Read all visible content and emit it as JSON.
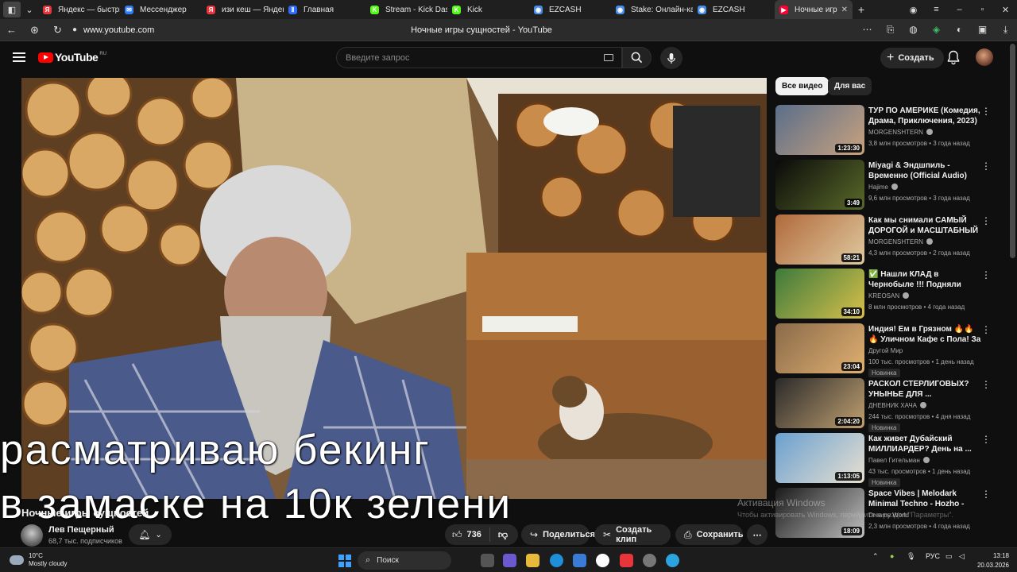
{
  "browser": {
    "tabs": [
      {
        "label": "Яндекс — быстрый",
        "color": "#e8343b",
        "glyph": "Я"
      },
      {
        "label": "Мессенджер",
        "color": "#2f7cf6",
        "glyph": "✉"
      },
      {
        "label": "изи кеш — Яндекс",
        "color": "#e8343b",
        "glyph": "Я"
      },
      {
        "label": "Главная",
        "color": "#2f6bff",
        "glyph": "Ⅱ"
      },
      {
        "label": "Stream - Kick Dash",
        "color": "#53fc18",
        "glyph": "K"
      },
      {
        "label": "Kick",
        "color": "#53fc18",
        "glyph": "K"
      },
      {
        "label": "EZCASH",
        "color": "#4a8fe7",
        "glyph": "◉"
      },
      {
        "label": "Stake: Онлайн-ка",
        "color": "#4a8fe7",
        "glyph": "◉"
      },
      {
        "label": "EZCASH",
        "color": "#4a8fe7",
        "glyph": "◉"
      },
      {
        "label": "Ночные игр",
        "color": "#ff0033",
        "glyph": "▶"
      }
    ],
    "url": "www.youtube.com",
    "page_title": "Ночные игры сущностей - YouTube"
  },
  "youtube": {
    "logo": "YouTube",
    "region": "RU",
    "search_placeholder": "Введите запрос",
    "create_label": "Создать"
  },
  "video": {
    "overlay_line1": "расматриваю бекинг",
    "overlay_line2": "в замаске  на 10к зелени",
    "title": "Ночные игры сущностей",
    "channel": "Лев Пещерный",
    "subscribers": "68,7 тыс. подписчиков",
    "likes": "736",
    "share_label": "Поделиться",
    "clip_label": "Создать клип",
    "save_label": "Сохранить"
  },
  "watermark": {
    "line1": "Активация Windows",
    "line2": "Чтобы активировать Windows, перейдите в раздел \"Параметры\"."
  },
  "chips": [
    "Все видео",
    "Для вас"
  ],
  "recommendations": [
    {
      "title": "ТУР ПО АМЕРИКЕ (Комедия, Драма, Приключения, 2023)",
      "channel": "MORGENSHTERN",
      "verified": true,
      "meta": "3,8 млн просмотров • 3 года назад",
      "duration": "1:23:30",
      "badge": "",
      "c1": "#5a6e8a",
      "c2": "#c9a27e"
    },
    {
      "title": "Miyagi & Эндшпиль - Временно (Official Audio)",
      "channel": "Hajime",
      "verified": true,
      "meta": "9,6 млн просмотров • 3 года назад",
      "duration": "3:49",
      "badge": "",
      "c1": "#0a0a0a",
      "c2": "#5a6a2a"
    },
    {
      "title": "Как мы снимали САМЫЙ ДОРОГОЙ и МАСШТАБНЫЙ ...",
      "channel": "MORGENSHTERN",
      "verified": true,
      "meta": "4,3 млн просмотров • 2 года назад",
      "duration": "58:21",
      "badge": "",
      "c1": "#b06a3a",
      "c2": "#e0c9a0"
    },
    {
      "title": "✅ Нашли КЛАД в Чернобыле !!! Подняли ДОМКРАТОМ ...",
      "channel": "KREOSAN",
      "verified": true,
      "meta": "8 млн просмотров • 4 года назад",
      "duration": "34:10",
      "badge": "",
      "c1": "#3c7a3c",
      "c2": "#d8c04a"
    },
    {
      "title": "Индия! Ем в Грязном 🔥🔥🔥 Уличном Кафе с Пола! За эт...",
      "channel": "Другой Мир",
      "verified": false,
      "meta": "100 тыс. просмотров • 1 день назад",
      "duration": "23:04",
      "badge": "Новинка",
      "c1": "#8a6a4a",
      "c2": "#e0b070"
    },
    {
      "title": "РАСКОЛ СТЕРЛИГОВЫХ? УНЫНЬЕ ДЛЯ ...",
      "channel": "ДНЕВНИК ХАЧА",
      "verified": true,
      "meta": "244 тыс. просмотров • 4 дня назад",
      "duration": "2:04:20",
      "badge": "Новинка",
      "c1": "#2a2a2a",
      "c2": "#c0a070"
    },
    {
      "title": "Как живет Дубайский МИЛЛИАРДЕР? День на ...",
      "channel": "Павел Гительман",
      "verified": true,
      "meta": "43 тыс. просмотров • 1 день назад",
      "duration": "1:13:05",
      "badge": "Новинка",
      "c1": "#6aa0d0",
      "c2": "#e8e0d0"
    },
    {
      "title": "Space Vibes | Melodark Minimal Techno - Hozho - EDM Best ...",
      "channel": "Dreamy World",
      "verified": false,
      "meta": "2,3 млн просмотров • 4 года назад",
      "duration": "18:09",
      "badge": "",
      "c1": "#1a1a1a",
      "c2": "#c0c0c0"
    }
  ],
  "taskbar": {
    "temp": "10°C",
    "weather": "Mostly cloudy",
    "search_label": "Поиск",
    "lang": "РУС",
    "time": "13:18",
    "date": "20.03.2026"
  }
}
